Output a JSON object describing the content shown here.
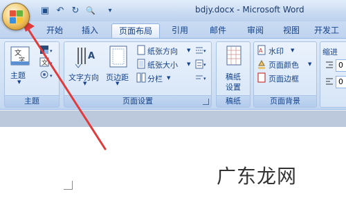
{
  "window": {
    "title": "bdjy.docx - Microsoft Word"
  },
  "quick_access": [
    {
      "name": "save-icon",
      "glyph": "▣"
    },
    {
      "name": "undo-icon",
      "glyph": "↶"
    },
    {
      "name": "redo-icon",
      "glyph": "↻"
    },
    {
      "name": "print-preview-icon",
      "glyph": "🔍"
    },
    {
      "name": "customize-icon",
      "glyph": "▾"
    }
  ],
  "tabs": [
    "开始",
    "插入",
    "页面布局",
    "引用",
    "邮件",
    "审阅",
    "视图",
    "开发工"
  ],
  "active_tab": "页面布局",
  "ribbon": {
    "theme_group": {
      "label": "主题",
      "theme_button": "主题"
    },
    "page_setup_group": {
      "label": "页面设置",
      "text_direction": "文字方向",
      "margins": "页边距",
      "orientation": "纸张方向",
      "size": "纸张大小",
      "columns": "分栏"
    },
    "manuscript_group": {
      "label": "稿纸",
      "button_line1": "稿纸",
      "button_line2": "设置"
    },
    "page_background_group": {
      "label": "页面背景",
      "watermark": "水印",
      "page_color": "页面颜色",
      "page_borders": "页面边框"
    },
    "paragraph_group": {
      "indent_label": "缩进",
      "value1": "0",
      "value2": "0"
    }
  },
  "watermark_text": "广东龙网",
  "colors": {
    "arrow": "#e03a3a",
    "ribbon_text": "#15428b"
  }
}
